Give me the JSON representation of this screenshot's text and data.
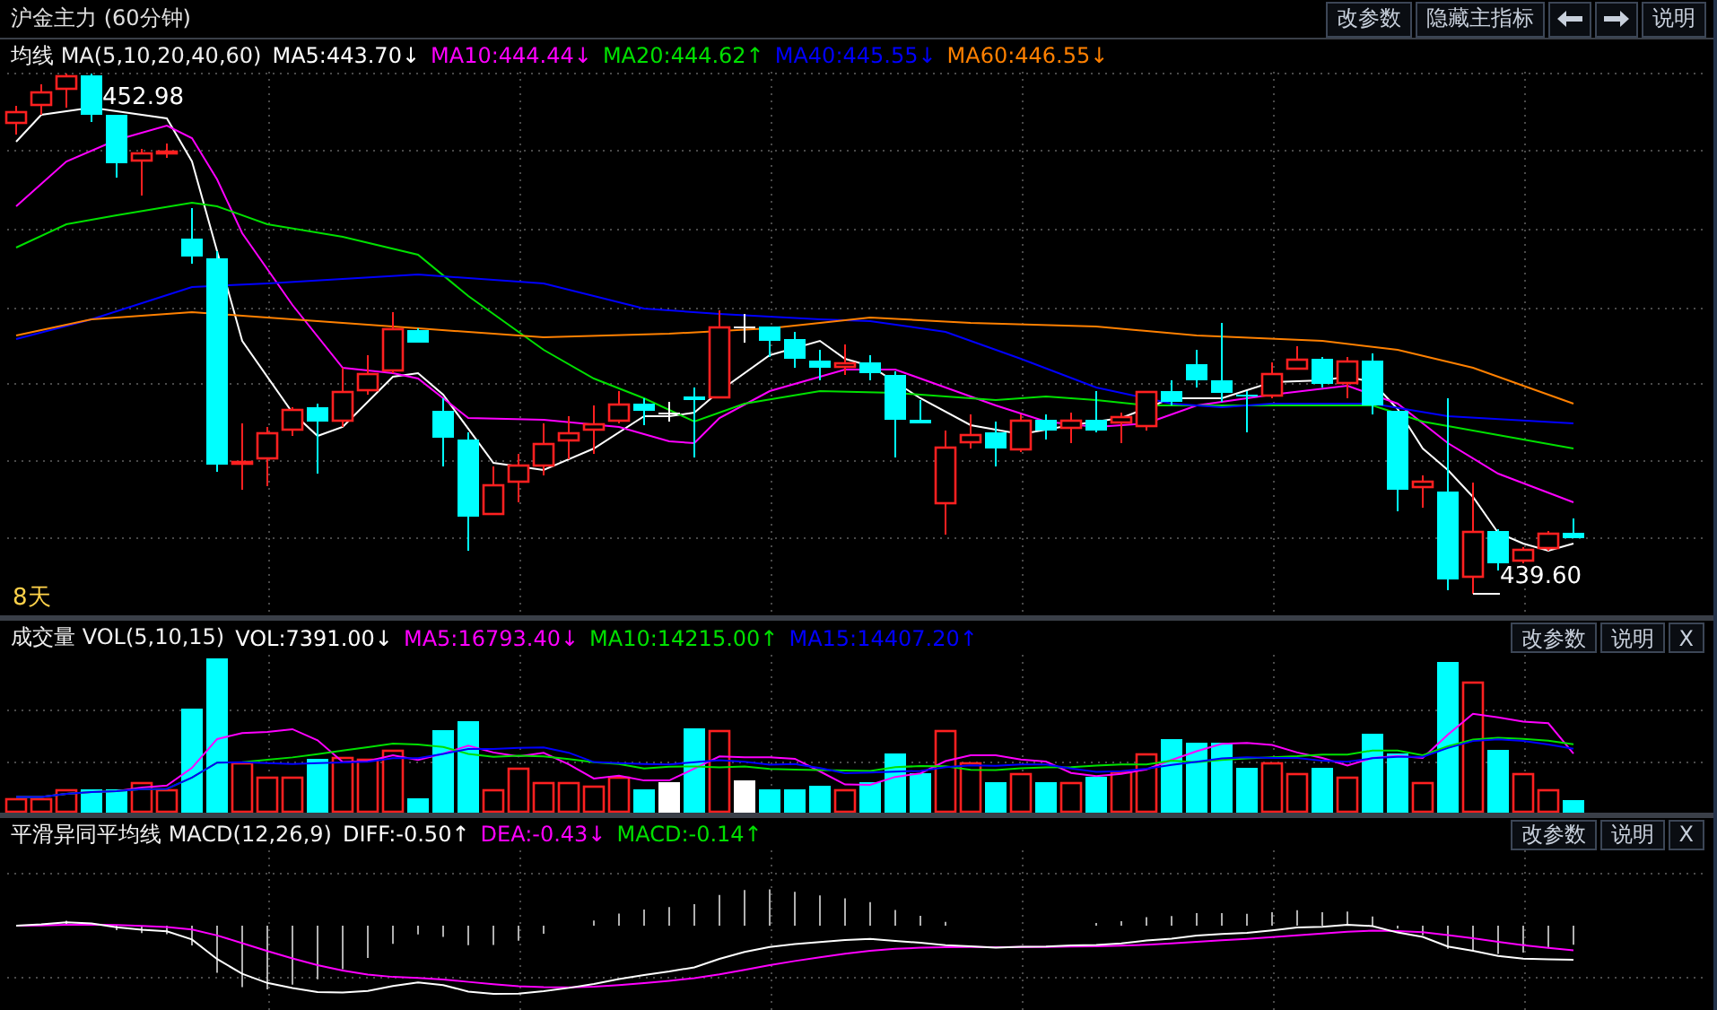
{
  "title": "沪金主力 (60分钟)",
  "toolbar": [
    {
      "kind": "text",
      "label": "改参数"
    },
    {
      "kind": "text",
      "label": "隐藏主指标"
    },
    {
      "kind": "left"
    },
    {
      "kind": "right"
    },
    {
      "kind": "text",
      "label": "说明"
    }
  ],
  "panels": [
    {
      "kind": "price",
      "name": "均线 MA(5,10,20,40,60)",
      "readings": [
        {
          "text": "MA5:443.70↓",
          "color": "#ffffff"
        },
        {
          "text": "MA10:444.44↓",
          "color": "#ff00ff"
        },
        {
          "text": "MA20:444.62↑",
          "color": "#00e000"
        },
        {
          "text": "MA40:445.55↓",
          "color": "#0000ff"
        },
        {
          "text": "MA60:446.55↓",
          "color": "#ff8000"
        }
      ],
      "high_label": "452.98",
      "low_label": "439.60",
      "period_label": "8天"
    },
    {
      "kind": "volume",
      "name": "成交量 VOL(5,10,15)",
      "readings": [
        {
          "text": "VOL:7391.00↓",
          "color": "#ffffff"
        },
        {
          "text": "MA5:16793.40↓",
          "color": "#ff00ff"
        },
        {
          "text": "MA10:14215.00↑",
          "color": "#00e000"
        },
        {
          "text": "MA15:14407.20↑",
          "color": "#0000ff"
        }
      ],
      "buttons": [
        "改参数",
        "说明",
        "X"
      ]
    },
    {
      "kind": "macd",
      "name": "平滑异同平均线 MACD(12,26,9)",
      "readings": [
        {
          "text": "DIFF:-0.50↑",
          "color": "#ffffff"
        },
        {
          "text": "DEA:-0.43↓",
          "color": "#ff00ff"
        },
        {
          "text": "MACD:-0.14↑",
          "color": "#00e000"
        }
      ],
      "buttons": [
        "改参数",
        "说明",
        "X"
      ]
    }
  ]
}
